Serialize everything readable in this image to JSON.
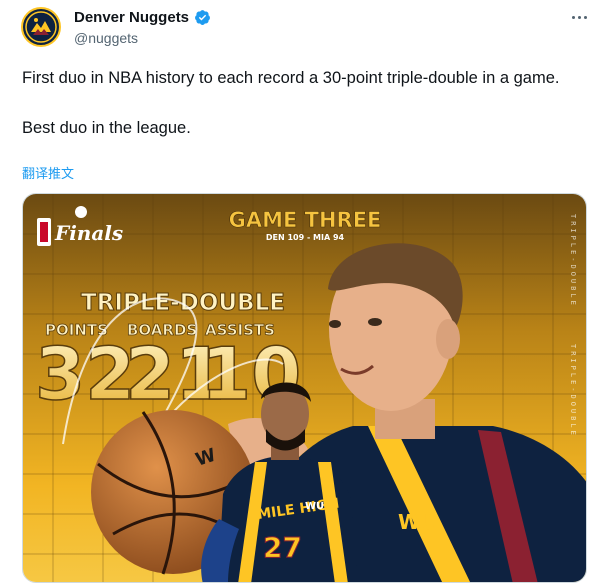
{
  "account": {
    "display_name": "Denver Nuggets",
    "handle": "@nuggets",
    "verified": true,
    "avatar_icon": "nuggets-logo-icon",
    "verified_icon": "verified-badge-icon",
    "more_icon": "more-options-icon"
  },
  "tweet": {
    "text_line1": "First duo in NBA history to each record a 30-point triple-double in a game.",
    "text_line2": "Best duo in the league.",
    "translate_label": "翻译推文"
  },
  "media": {
    "brand": "Finals",
    "game_title": "GAME THREE",
    "score": "DEN 109 - MIA 94",
    "headline": "TRIPLE-DOUBLE",
    "stats": [
      {
        "label": "POINTS",
        "value": "32"
      },
      {
        "label": "BOARDS",
        "value": "21"
      },
      {
        "label": "ASSISTS",
        "value": "10"
      }
    ],
    "side_text": "TRIPLE-DOUBLE",
    "jersey_text": "MILE HIGH",
    "jersey_number": "27",
    "sponsor": "WU",
    "colors": {
      "gold": "#f2b523",
      "navy": "#0e2240",
      "blue": "#1d428a",
      "accent": "#1d9bf0"
    }
  }
}
